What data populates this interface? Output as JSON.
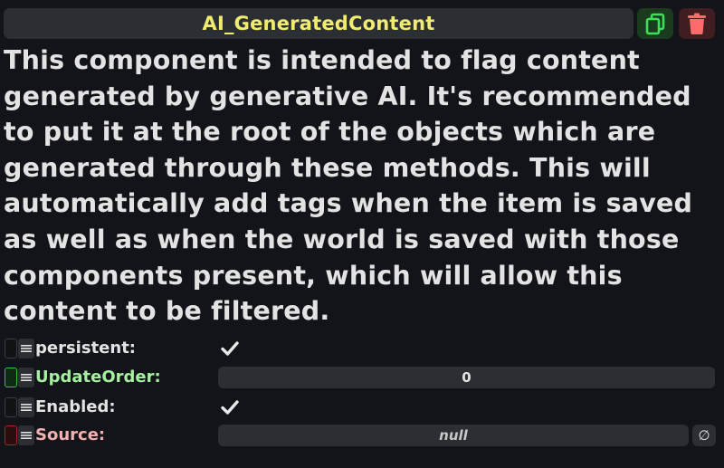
{
  "header": {
    "title": "AI_GeneratedContent",
    "duplicate_icon": "duplicate-icon",
    "delete_icon": "trash-icon"
  },
  "description": "This component is intended to flag content generated by generative AI. It's recommended to put it at the root of the objects which are generated through these methods. This will automatically add tags when the item is saved as well as when the world is saved with those components present, which will allow this content to be filtered.",
  "fields": {
    "persistent": {
      "label": "persistent:",
      "checked": true,
      "drive_state": "none"
    },
    "update_order": {
      "label": "UpdateOrder:",
      "value": "0",
      "drive_state": "driven-green"
    },
    "enabled": {
      "label": "Enabled:",
      "checked": true,
      "drive_state": "none"
    },
    "source": {
      "label": "Source:",
      "value": "null",
      "clear_symbol": "∅",
      "drive_state": "linked-red"
    }
  },
  "colors": {
    "background": "#121419",
    "title": "#f2ec6e",
    "duplicate_button": "#1b3b1e",
    "delete_button": "#3f1d20",
    "driven_green": "#34c04a",
    "linked_red": "#a82525"
  }
}
